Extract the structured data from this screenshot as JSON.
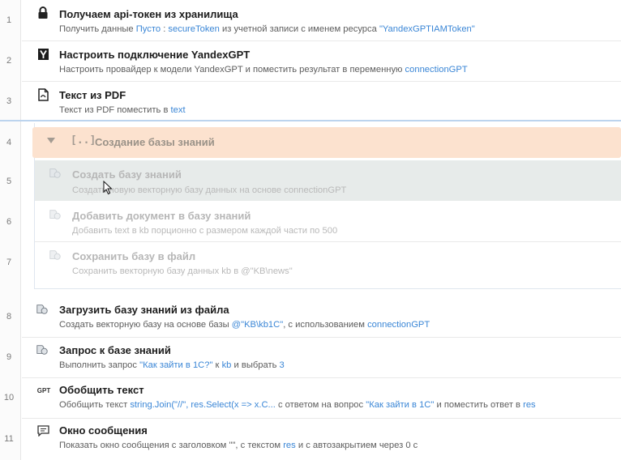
{
  "steps": [
    {
      "num": "1",
      "icon": "lock-icon",
      "title": "Получаем api-токен из хранилища",
      "desc": [
        {
          "t": "Получить данные ",
          "hl": false
        },
        {
          "t": "Пусто",
          "hl": true
        },
        {
          "t": " : ",
          "hl": false
        },
        {
          "t": "secureToken",
          "hl": true
        },
        {
          "t": " из учетной записи с именем ресурса ",
          "hl": false
        },
        {
          "t": "\"YandexGPTIAMToken\"",
          "hl": true
        }
      ]
    },
    {
      "num": "2",
      "icon": "yandex-logo-icon",
      "title": "Настроить подключение YandexGPT",
      "desc": [
        {
          "t": "Настроить провайдер к модели YandexGPT и поместить результат в переменную ",
          "hl": false
        },
        {
          "t": "connectionGPT",
          "hl": true
        }
      ]
    },
    {
      "num": "3",
      "icon": "pdf-document-icon",
      "title": "Текст из PDF",
      "desc": [
        {
          "t": "Текст из PDF поместить в ",
          "hl": false
        },
        {
          "t": "text",
          "hl": true
        }
      ]
    },
    {
      "num": "4",
      "icon": "group-brackets-icon",
      "title": "Создание базы знаний",
      "desc": []
    },
    {
      "num": "5",
      "icon": "knowledge-base-icon",
      "title": "Создать базу знаний",
      "desc": [
        {
          "t": "Создать новую векторную базу данных на основе connectionGPT",
          "hl": false
        }
      ]
    },
    {
      "num": "6",
      "icon": "knowledge-base-icon",
      "title": "Добавить документ в базу знаний",
      "desc": [
        {
          "t": "Добавить text в kb порционно с размером каждой части по 500",
          "hl": false
        }
      ]
    },
    {
      "num": "7",
      "icon": "knowledge-base-icon",
      "title": "Сохранить базу в файл",
      "desc": [
        {
          "t": "Сохранить векторную базу данных kb в @\"KB\\news\"",
          "hl": false
        }
      ]
    },
    {
      "num": "8",
      "icon": "knowledge-base-icon",
      "title": "Загрузить базу знаний из файла",
      "desc": [
        {
          "t": "Создать векторную базу на основе базы ",
          "hl": false
        },
        {
          "t": "@\"KB\\kb1C\"",
          "hl": true
        },
        {
          "t": ", с использованием ",
          "hl": false
        },
        {
          "t": "connectionGPT",
          "hl": true
        }
      ]
    },
    {
      "num": "9",
      "icon": "knowledge-base-icon",
      "title": "Запрос к базе знаний",
      "desc": [
        {
          "t": "Выполнить запрос ",
          "hl": false
        },
        {
          "t": "\"Как зайти в 1С?\"",
          "hl": true
        },
        {
          "t": " к ",
          "hl": false
        },
        {
          "t": "kb",
          "hl": true
        },
        {
          "t": " и выбрать ",
          "hl": false
        },
        {
          "t": "3",
          "hl": true
        }
      ]
    },
    {
      "num": "10",
      "icon": "gpt-icon",
      "icon_text": "GPT",
      "title": "Обобщить текст",
      "desc": [
        {
          "t": "Обобщить текст ",
          "hl": false
        },
        {
          "t": "string.Join(\"//\", res.Select(x => x.C...",
          "hl": true
        },
        {
          "t": " с ответом на вопрос ",
          "hl": false
        },
        {
          "t": "\"Как зайти в 1С\"",
          "hl": true
        },
        {
          "t": " и поместить ответ в ",
          "hl": false
        },
        {
          "t": "res",
          "hl": true
        }
      ]
    },
    {
      "num": "11",
      "icon": "message-box-icon",
      "title": "Окно сообщения",
      "desc": [
        {
          "t": "Показать окно сообщения с заголовком \"\", с текстом ",
          "hl": false
        },
        {
          "t": "res",
          "hl": true
        },
        {
          "t": " и с автозакрытием через 0 с",
          "hl": false
        }
      ]
    }
  ],
  "colors": {
    "highlight": "#3a86d6",
    "group_header": "#fce2cf",
    "selected_row": "#e7ebea"
  }
}
